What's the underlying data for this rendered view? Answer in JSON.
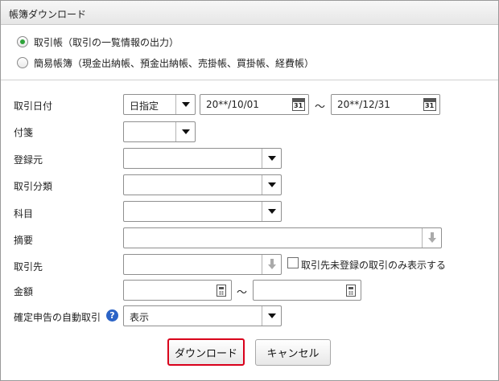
{
  "panel": {
    "title": "帳簿ダウンロード"
  },
  "book_type": {
    "options": [
      {
        "label": "取引帳（取引の一覧情報の出力）",
        "checked": true
      },
      {
        "label": "簡易帳簿（現金出納帳、預金出納帳、売掛帳、買掛帳、経費帳）",
        "checked": false
      }
    ]
  },
  "form": {
    "date": {
      "label": "取引日付",
      "mode": "日指定",
      "from": "20**/10/01",
      "to": "20**/12/31",
      "range_sep": "〜",
      "calendar_glyph": "31"
    },
    "tag": {
      "label": "付箋",
      "value": ""
    },
    "registration_source": {
      "label": "登録元",
      "value": ""
    },
    "transaction_category": {
      "label": "取引分類",
      "value": ""
    },
    "account_item": {
      "label": "科目",
      "value": ""
    },
    "description": {
      "label": "摘要",
      "value": ""
    },
    "partner": {
      "label": "取引先",
      "value": "",
      "unregistered_only_label": "取引先未登録の取引のみ表示する",
      "unregistered_only_checked": false
    },
    "amount": {
      "label": "金額",
      "from": "",
      "to": "",
      "range_sep": "〜"
    },
    "tax_auto": {
      "label": "確定申告の自動取引",
      "value": "表示",
      "help_glyph": "?"
    }
  },
  "actions": {
    "download_label": "ダウンロード",
    "cancel_label": "キャンセル"
  }
}
